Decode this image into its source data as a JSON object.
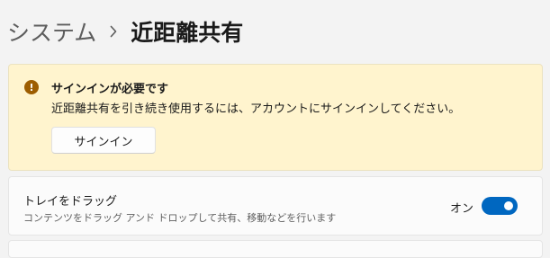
{
  "breadcrumb": {
    "parent": "システム",
    "separator_icon": "chevron-right-icon",
    "current": "近距離共有"
  },
  "banner": {
    "icon": "warning-icon",
    "icon_glyph": "!",
    "title": "サインインが必要です",
    "message": "近距離共有を引き続き使用するには、アカウントにサインインしてください。",
    "button_label": "サインイン",
    "background": "#fff4ce",
    "icon_color": "#9d5d00"
  },
  "setting": {
    "title": "トレイをドラッグ",
    "description": "コンテンツをドラッグ アンド ドロップして共有、移動などを行います",
    "toggle_state_label": "オン",
    "toggle_on": true,
    "accent": "#0067c0"
  }
}
